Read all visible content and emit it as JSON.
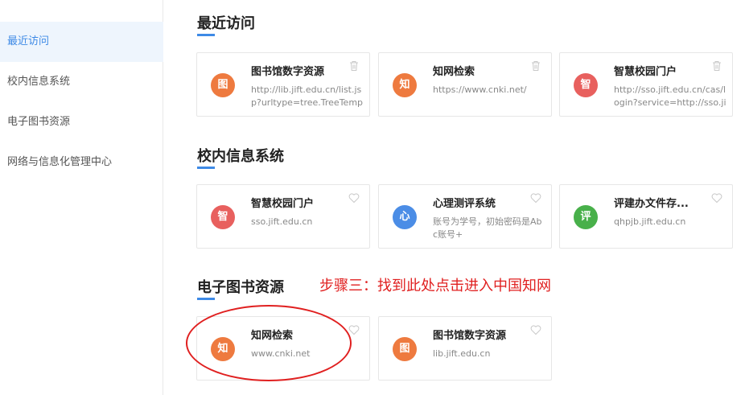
{
  "sidebar": {
    "items": [
      {
        "label": "最近访问",
        "active": true
      },
      {
        "label": "校内信息系统",
        "active": false
      },
      {
        "label": "电子图书资源",
        "active": false
      },
      {
        "label": "网络与信息化管理中心",
        "active": false
      }
    ]
  },
  "sections": {
    "recent": {
      "title": "最近访问",
      "cards": [
        {
          "icon_char": "图",
          "color": "#ee7a3f",
          "title": "图书馆数字资源",
          "desc": "http://lib.jift.edu.cn/list.jsp?urltype=tree.TreeTempUrl",
          "action_icon": "trash-icon"
        },
        {
          "icon_char": "知",
          "color": "#ee7a3f",
          "title": "知网检索",
          "desc": "https://www.cnki.net/",
          "action_icon": "trash-icon"
        },
        {
          "icon_char": "智",
          "color": "#e8605e",
          "title": "智慧校园门户",
          "desc": "http://sso.jift.edu.cn/cas/login?service=http://sso.jift.edu.cn",
          "action_icon": "trash-icon"
        }
      ]
    },
    "campus": {
      "title": "校内信息系统",
      "cards": [
        {
          "icon_char": "智",
          "color": "#e8605e",
          "title": "智慧校园门户",
          "desc": "sso.jift.edu.cn",
          "action_icon": "favorite-heart-icon"
        },
        {
          "icon_char": "心",
          "color": "#4b8de6",
          "title": "心理测评系统",
          "desc": "账号为学号，初始密码是Abc账号+",
          "action_icon": "favorite-heart-icon"
        },
        {
          "icon_char": "评",
          "color": "#48b04a",
          "title": "评建办文件存...",
          "desc": "qhpjb.jift.edu.cn",
          "action_icon": "favorite-heart-icon"
        }
      ]
    },
    "ebooks": {
      "title": "电子图书资源",
      "annotation": "步骤三：找到此处点击进入中国知网",
      "cards": [
        {
          "icon_char": "知",
          "color": "#ee7a3f",
          "title": "知网检索",
          "desc": "www.cnki.net",
          "action_icon": "favorite-heart-icon"
        },
        {
          "icon_char": "图",
          "color": "#ee7a3f",
          "title": "图书馆数字资源",
          "desc": "lib.jift.edu.cn",
          "action_icon": "favorite-heart-icon"
        }
      ]
    }
  }
}
